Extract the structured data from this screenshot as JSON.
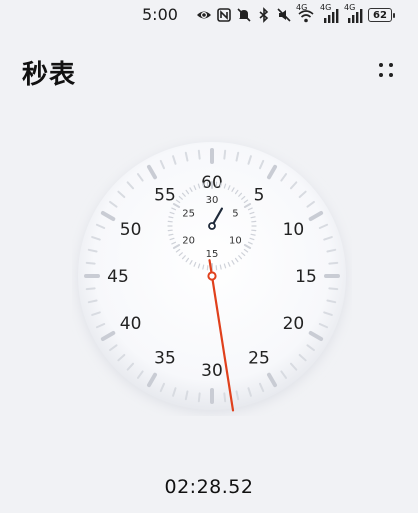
{
  "status_bar": {
    "time": "5:00",
    "battery": "62",
    "icons": [
      "eye-icon",
      "nfc-icon",
      "mute-icon",
      "bluetooth-icon",
      "silent-icon",
      "wifi-icon",
      "signal-4g-icon",
      "signal-4g-icon",
      "battery-icon"
    ],
    "signal_labels": [
      "4G",
      "4G",
      "4G"
    ]
  },
  "header": {
    "title": "秒表",
    "menu_icon": "more-dots-icon"
  },
  "dial": {
    "major_labels": [
      "60",
      "5",
      "10",
      "15",
      "20",
      "25",
      "30",
      "35",
      "40",
      "45",
      "50",
      "55"
    ],
    "minor_labels": [
      "30",
      "5",
      "10",
      "15",
      "20",
      "25"
    ],
    "main_hand_seconds": 28.52,
    "sub_hand_minutes": 2.475,
    "accent_color": "#e0401c",
    "sub_hand_color": "#1f2a3a"
  },
  "elapsed_time": "02:28.52"
}
